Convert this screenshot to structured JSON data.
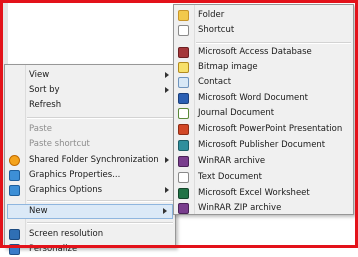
{
  "context_menu": {
    "items": [
      {
        "label": "View",
        "submenu": true
      },
      {
        "label": "Sort by",
        "submenu": true
      },
      {
        "label": "Refresh"
      },
      {
        "label": "Paste",
        "disabled": true
      },
      {
        "label": "Paste shortcut",
        "disabled": true
      },
      {
        "label": "Shared Folder Synchronization",
        "submenu": true,
        "icon": "sync-icon"
      },
      {
        "label": "Graphics Properties...",
        "icon": "intel-graphics-icon"
      },
      {
        "label": "Graphics Options",
        "submenu": true,
        "icon": "intel-graphics-icon"
      },
      {
        "label": "New",
        "submenu": true,
        "highlighted": true
      },
      {
        "label": "Screen resolution",
        "icon": "monitor-icon"
      },
      {
        "label": "Personalize",
        "icon": "personalize-icon"
      }
    ]
  },
  "new_menu": {
    "items": [
      {
        "label": "Folder",
        "icon": "folder-icon"
      },
      {
        "label": "Shortcut",
        "icon": "shortcut-icon"
      },
      {
        "label": "Microsoft Access Database",
        "icon": "access-icon"
      },
      {
        "label": "Bitmap image",
        "icon": "bitmap-icon"
      },
      {
        "label": "Contact",
        "icon": "contact-icon"
      },
      {
        "label": "Microsoft Word Document",
        "icon": "word-icon"
      },
      {
        "label": "Journal Document",
        "icon": "journal-icon"
      },
      {
        "label": "Microsoft PowerPoint Presentation",
        "icon": "powerpoint-icon"
      },
      {
        "label": "Microsoft Publisher Document",
        "icon": "publisher-icon"
      },
      {
        "label": "WinRAR archive",
        "icon": "winrar-icon"
      },
      {
        "label": "Text Document",
        "icon": "text-document-icon"
      },
      {
        "label": "Microsoft Excel Worksheet",
        "icon": "excel-icon"
      },
      {
        "label": "WinRAR ZIP archive",
        "icon": "winrar-zip-icon"
      }
    ]
  },
  "colors": {
    "frame": "#e3121a",
    "highlight": "#dbe9f7",
    "menu_bg": "#f0f0f0"
  }
}
